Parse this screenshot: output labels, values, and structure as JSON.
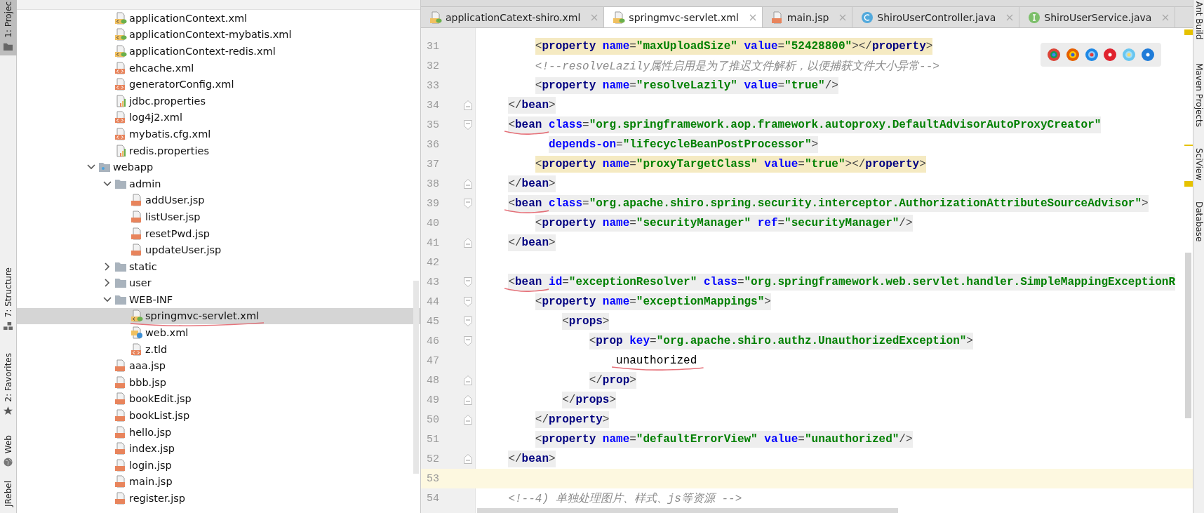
{
  "left_tool_tabs": [
    {
      "label": "1: Projec",
      "selected": true
    },
    {
      "label": "7: Structure",
      "selected": false
    },
    {
      "label": "2: Favorites",
      "selected": false
    },
    {
      "label": "Web",
      "selected": false
    },
    {
      "label": "JRebel",
      "selected": false
    }
  ],
  "tree": [
    {
      "kind": "offscreen",
      "children": [
        {
          "label": "applicationContext.xml",
          "kind": "spring-xml",
          "selected": false,
          "underlined": false
        },
        {
          "label": "applicationContext-mybatis.xml",
          "kind": "spring-xml",
          "selected": false,
          "underlined": false
        },
        {
          "label": "applicationContext-redis.xml",
          "kind": "spring-xml",
          "selected": false,
          "underlined": false
        },
        {
          "label": "ehcache.xml",
          "kind": "xml",
          "selected": false,
          "underlined": false
        },
        {
          "label": "generatorConfig.xml",
          "kind": "xml",
          "selected": false,
          "underlined": false
        },
        {
          "label": "jdbc.properties",
          "kind": "properties",
          "selected": false,
          "underlined": false
        },
        {
          "label": "log4j2.xml",
          "kind": "xml",
          "selected": false,
          "underlined": false
        },
        {
          "label": "mybatis.cfg.xml",
          "kind": "xml",
          "selected": false,
          "underlined": false
        },
        {
          "label": "redis.properties",
          "kind": "properties",
          "selected": false,
          "underlined": false
        }
      ]
    },
    {
      "label": "webapp",
      "kind": "web-folder",
      "expanded": true,
      "selected": false,
      "underlined": false,
      "children": [
        {
          "label": "admin",
          "kind": "folder",
          "expanded": true,
          "selected": false,
          "underlined": false,
          "children": [
            {
              "label": "addUser.jsp",
              "kind": "jsp",
              "selected": false,
              "underlined": false
            },
            {
              "label": "listUser.jsp",
              "kind": "jsp",
              "selected": false,
              "underlined": false
            },
            {
              "label": "resetPwd.jsp",
              "kind": "jsp",
              "selected": false,
              "underlined": false
            },
            {
              "label": "updateUser.jsp",
              "kind": "jsp",
              "selected": false,
              "underlined": false
            }
          ]
        },
        {
          "label": "static",
          "kind": "folder",
          "expanded": false,
          "selected": false,
          "underlined": false
        },
        {
          "label": "user",
          "kind": "folder",
          "expanded": false,
          "selected": false,
          "underlined": false
        },
        {
          "label": "WEB-INF",
          "kind": "folder",
          "expanded": true,
          "selected": false,
          "underlined": false,
          "children": [
            {
              "label": "springmvc-servlet.xml",
              "kind": "spring-xml",
              "selected": true,
              "underlined": true
            },
            {
              "label": "web.xml",
              "kind": "web-xml",
              "selected": false,
              "underlined": false
            },
            {
              "label": "z.tld",
              "kind": "xml",
              "selected": false,
              "underlined": false
            }
          ]
        },
        {
          "label": "aaa.jsp",
          "kind": "jsp",
          "selected": false,
          "underlined": false
        },
        {
          "label": "bbb.jsp",
          "kind": "jsp",
          "selected": false,
          "underlined": false
        },
        {
          "label": "bookEdit.jsp",
          "kind": "jsp",
          "selected": false,
          "underlined": false
        },
        {
          "label": "bookList.jsp",
          "kind": "jsp",
          "selected": false,
          "underlined": false
        },
        {
          "label": "hello.jsp",
          "kind": "jsp",
          "selected": false,
          "underlined": false
        },
        {
          "label": "index.jsp",
          "kind": "jsp",
          "selected": false,
          "underlined": false
        },
        {
          "label": "login.jsp",
          "kind": "jsp",
          "selected": false,
          "underlined": false
        },
        {
          "label": "main.jsp",
          "kind": "jsp",
          "selected": false,
          "underlined": false
        },
        {
          "label": "register.jsp",
          "kind": "jsp",
          "selected": false,
          "underlined": false
        }
      ]
    }
  ],
  "editor_tabs": [
    {
      "label": "applicationCatext-shiro.xml",
      "kind": "spring-xml",
      "selected": false
    },
    {
      "label": "springmvc-servlet.xml",
      "kind": "spring-xml",
      "selected": true
    },
    {
      "label": "main.jsp",
      "kind": "jsp",
      "selected": false
    },
    {
      "label": "ShiroUserController.java",
      "kind": "class",
      "selected": false
    },
    {
      "label": "ShiroUserService.java",
      "kind": "interface",
      "selected": false
    }
  ],
  "lines": [
    {
      "number": "31",
      "kind": "plain",
      "matched": true,
      "highlighted": false,
      "current": false,
      "underlined": false,
      "segments": [
        {
          "kind": "punct",
          "text": "        <"
        },
        {
          "kind": "tag",
          "text": "property "
        },
        {
          "kind": "attr",
          "text": "name"
        },
        {
          "kind": "punct",
          "text": "="
        },
        {
          "kind": "value",
          "text": "\"maxUploadSize\" "
        },
        {
          "kind": "attr",
          "text": "value"
        },
        {
          "kind": "punct",
          "text": "="
        },
        {
          "kind": "value",
          "text": "\"52428800\""
        },
        {
          "kind": "punct",
          "text": "></"
        },
        {
          "kind": "tag",
          "text": "property"
        },
        {
          "kind": "punct",
          "text": ">"
        }
      ]
    },
    {
      "number": "32",
      "kind": "plain",
      "matched": false,
      "highlighted": false,
      "current": false,
      "underlined": false,
      "segments": [
        {
          "kind": "comment",
          "text": "        <!--resolveLazily属性启用是为了推迟文件解析，以便捕获文件大小异常-->"
        }
      ]
    },
    {
      "number": "33",
      "kind": "plain",
      "matched": false,
      "highlighted": true,
      "current": false,
      "underlined": false,
      "segments": [
        {
          "kind": "punct",
          "text": "        <"
        },
        {
          "kind": "tag",
          "text": "property "
        },
        {
          "kind": "attr",
          "text": "name"
        },
        {
          "kind": "punct",
          "text": "="
        },
        {
          "kind": "value",
          "text": "\"resolveLazily\" "
        },
        {
          "kind": "attr",
          "text": "value"
        },
        {
          "kind": "punct",
          "text": "="
        },
        {
          "kind": "value",
          "text": "\"true\""
        },
        {
          "kind": "punct",
          "text": "/>"
        }
      ]
    },
    {
      "number": "34",
      "kind": "block-end",
      "matched": false,
      "highlighted": true,
      "current": false,
      "underlined": false,
      "segments": [
        {
          "kind": "punct",
          "text": "    </"
        },
        {
          "kind": "tag",
          "text": "bean"
        },
        {
          "kind": "punct",
          "text": ">"
        }
      ]
    },
    {
      "number": "35",
      "kind": "block-start",
      "matched": false,
      "highlighted": true,
      "current": false,
      "underlined": true,
      "segments": [
        {
          "kind": "punct",
          "text": "    <"
        },
        {
          "kind": "tag",
          "text": "bean "
        },
        {
          "kind": "attr",
          "text": "class"
        },
        {
          "kind": "punct",
          "text": "="
        },
        {
          "kind": "value",
          "text": "\"org.springframework.aop.framework.autoproxy.DefaultAdvisorAutoProxyCreator\""
        }
      ]
    },
    {
      "number": "36",
      "kind": "plain",
      "matched": false,
      "highlighted": true,
      "current": false,
      "underlined": false,
      "segments": [
        {
          "kind": "attr",
          "text": "          depends-on"
        },
        {
          "kind": "punct",
          "text": "="
        },
        {
          "kind": "value",
          "text": "\"lifecycleBeanPostProcessor\""
        },
        {
          "kind": "punct",
          "text": ">"
        }
      ]
    },
    {
      "number": "37",
      "kind": "plain",
      "matched": true,
      "highlighted": false,
      "current": false,
      "underlined": false,
      "segments": [
        {
          "kind": "punct",
          "text": "        <"
        },
        {
          "kind": "tag",
          "text": "property "
        },
        {
          "kind": "attr",
          "text": "name"
        },
        {
          "kind": "punct",
          "text": "="
        },
        {
          "kind": "value",
          "text": "\"proxyTargetClass\" "
        },
        {
          "kind": "attr",
          "text": "value"
        },
        {
          "kind": "punct",
          "text": "="
        },
        {
          "kind": "value",
          "text": "\"true\""
        },
        {
          "kind": "punct",
          "text": "></"
        },
        {
          "kind": "tag",
          "text": "property"
        },
        {
          "kind": "punct",
          "text": ">"
        }
      ]
    },
    {
      "number": "38",
      "kind": "block-end",
      "matched": false,
      "highlighted": true,
      "current": false,
      "underlined": false,
      "segments": [
        {
          "kind": "punct",
          "text": "    </"
        },
        {
          "kind": "tag",
          "text": "bean"
        },
        {
          "kind": "punct",
          "text": ">"
        }
      ]
    },
    {
      "number": "39",
      "kind": "block-start",
      "matched": false,
      "highlighted": true,
      "current": false,
      "underlined": true,
      "segments": [
        {
          "kind": "punct",
          "text": "    <"
        },
        {
          "kind": "tag",
          "text": "bean "
        },
        {
          "kind": "attr",
          "text": "class"
        },
        {
          "kind": "punct",
          "text": "="
        },
        {
          "kind": "value",
          "text": "\"org.apache.shiro.spring.security.interceptor.AuthorizationAttributeSourceAdvisor\""
        },
        {
          "kind": "punct",
          "text": ">"
        }
      ]
    },
    {
      "number": "40",
      "kind": "plain",
      "matched": false,
      "highlighted": true,
      "current": false,
      "underlined": false,
      "segments": [
        {
          "kind": "punct",
          "text": "        <"
        },
        {
          "kind": "tag",
          "text": "property "
        },
        {
          "kind": "attr",
          "text": "name"
        },
        {
          "kind": "punct",
          "text": "="
        },
        {
          "kind": "value",
          "text": "\"securityManager\" "
        },
        {
          "kind": "attr",
          "text": "ref"
        },
        {
          "kind": "punct",
          "text": "="
        },
        {
          "kind": "value",
          "text": "\"securityManager\""
        },
        {
          "kind": "punct",
          "text": "/>"
        }
      ]
    },
    {
      "number": "41",
      "kind": "block-end",
      "matched": false,
      "highlighted": true,
      "current": false,
      "underlined": false,
      "segments": [
        {
          "kind": "punct",
          "text": "    </"
        },
        {
          "kind": "tag",
          "text": "bean"
        },
        {
          "kind": "punct",
          "text": ">"
        }
      ]
    },
    {
      "number": "42",
      "kind": "plain",
      "current": false,
      "underlined": false
    },
    {
      "number": "43",
      "kind": "block-start",
      "matched": false,
      "highlighted": true,
      "current": false,
      "underlined": true,
      "segments": [
        {
          "kind": "punct",
          "text": "    <"
        },
        {
          "kind": "tag",
          "text": "bean "
        },
        {
          "kind": "attr",
          "text": "id"
        },
        {
          "kind": "punct",
          "text": "="
        },
        {
          "kind": "value",
          "text": "\"exceptionResolver\" "
        },
        {
          "kind": "attr",
          "text": "class"
        },
        {
          "kind": "punct",
          "text": "="
        },
        {
          "kind": "value",
          "text": "\"org.springframework.web.servlet.handler.SimpleMappingExceptionR"
        }
      ]
    },
    {
      "number": "44",
      "kind": "block-start",
      "matched": false,
      "highlighted": true,
      "current": false,
      "underlined": false,
      "segments": [
        {
          "kind": "punct",
          "text": "        <"
        },
        {
          "kind": "tag",
          "text": "property "
        },
        {
          "kind": "attr",
          "text": "name"
        },
        {
          "kind": "punct",
          "text": "="
        },
        {
          "kind": "value",
          "text": "\"exceptionMappings\""
        },
        {
          "kind": "punct",
          "text": ">"
        }
      ]
    },
    {
      "number": "45",
      "kind": "block-start",
      "matched": false,
      "highlighted": true,
      "current": false,
      "underlined": false,
      "segments": [
        {
          "kind": "punct",
          "text": "            <"
        },
        {
          "kind": "tag",
          "text": "props"
        },
        {
          "kind": "punct",
          "text": ">"
        }
      ]
    },
    {
      "number": "46",
      "kind": "block-start",
      "matched": false,
      "highlighted": true,
      "current": false,
      "underlined": false,
      "segments": [
        {
          "kind": "punct",
          "text": "                <"
        },
        {
          "kind": "tag",
          "text": "prop "
        },
        {
          "kind": "attr",
          "text": "key"
        },
        {
          "kind": "punct",
          "text": "="
        },
        {
          "kind": "value",
          "text": "\"org.apache.shiro.authz.UnauthorizedException\""
        },
        {
          "kind": "punct",
          "text": ">"
        }
      ]
    },
    {
      "number": "47",
      "kind": "plain",
      "matched": false,
      "highlighted": false,
      "current": false,
      "underlined": true,
      "segments": [
        {
          "kind": "text",
          "text": "                    unauthorized"
        }
      ]
    },
    {
      "number": "48",
      "kind": "block-end",
      "matched": false,
      "highlighted": true,
      "current": false,
      "underlined": false,
      "segments": [
        {
          "kind": "punct",
          "text": "                </"
        },
        {
          "kind": "tag",
          "text": "prop"
        },
        {
          "kind": "punct",
          "text": ">"
        }
      ]
    },
    {
      "number": "49",
      "kind": "block-end",
      "matched": false,
      "highlighted": true,
      "current": false,
      "underlined": false,
      "segments": [
        {
          "kind": "punct",
          "text": "            </"
        },
        {
          "kind": "tag",
          "text": "props"
        },
        {
          "kind": "punct",
          "text": ">"
        }
      ]
    },
    {
      "number": "50",
      "kind": "block-end",
      "matched": false,
      "highlighted": true,
      "current": false,
      "underlined": false,
      "segments": [
        {
          "kind": "punct",
          "text": "        </"
        },
        {
          "kind": "tag",
          "text": "property"
        },
        {
          "kind": "punct",
          "text": ">"
        }
      ]
    },
    {
      "number": "51",
      "kind": "plain",
      "matched": false,
      "highlighted": true,
      "current": false,
      "underlined": false,
      "segments": [
        {
          "kind": "punct",
          "text": "        <"
        },
        {
          "kind": "tag",
          "text": "property "
        },
        {
          "kind": "attr",
          "text": "name"
        },
        {
          "kind": "punct",
          "text": "="
        },
        {
          "kind": "value",
          "text": "\"defaultErrorView\" "
        },
        {
          "kind": "attr",
          "text": "value"
        },
        {
          "kind": "punct",
          "text": "="
        },
        {
          "kind": "value",
          "text": "\"unauthorized\""
        },
        {
          "kind": "punct",
          "text": "/>"
        }
      ]
    },
    {
      "number": "52",
      "kind": "block-end",
      "matched": false,
      "highlighted": true,
      "current": false,
      "underlined": false,
      "segments": [
        {
          "kind": "punct",
          "text": "    </"
        },
        {
          "kind": "tag",
          "text": "bean"
        },
        {
          "kind": "punct",
          "text": ">"
        }
      ]
    },
    {
      "number": "53",
      "kind": "plain",
      "current": true,
      "underlined": false
    },
    {
      "number": "54",
      "kind": "plain",
      "matched": false,
      "highlighted": false,
      "current": false,
      "underlined": false,
      "segments": [
        {
          "kind": "comment",
          "text": "    <!--4) 单独处理图片、样式、js等资源 -->"
        }
      ]
    }
  ],
  "right_tool_tabs": [
    {
      "label": "Ant Build"
    },
    {
      "label": "Maven Projects"
    },
    {
      "label": "SciView"
    },
    {
      "label": "Database"
    }
  ]
}
